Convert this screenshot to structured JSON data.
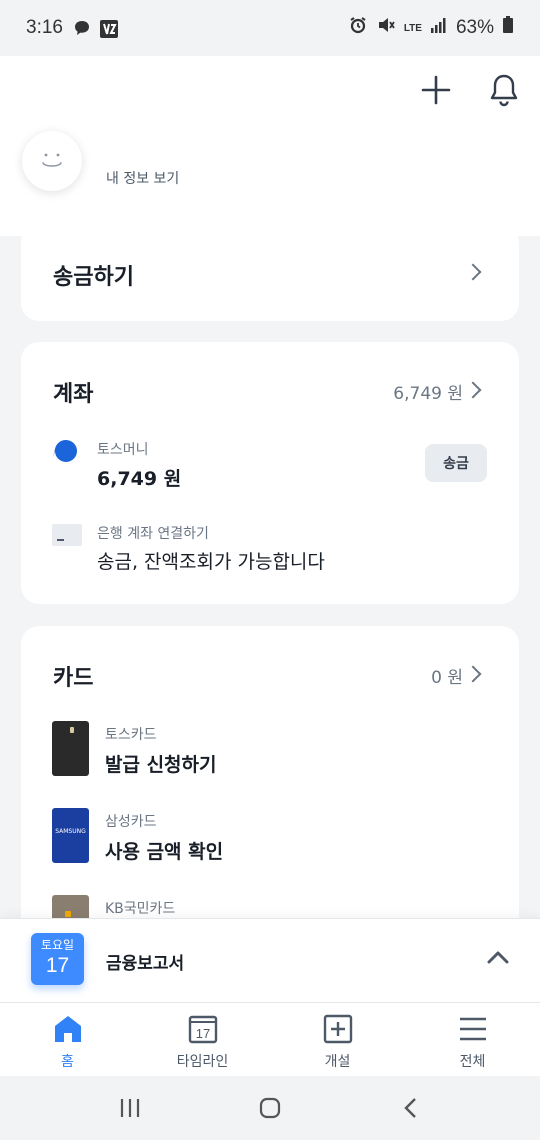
{
  "status_bar": {
    "time": "3:16",
    "network": "LTE",
    "battery": "63%"
  },
  "header": {
    "add_icon": "plus-icon",
    "notification_icon": "bell-icon",
    "profile_link": "내 정보 보기"
  },
  "transfer": {
    "title": "송금하기"
  },
  "accounts": {
    "title": "계좌",
    "total": "6,749 원",
    "items": [
      {
        "sub": "토스머니",
        "main": "6,749 원",
        "button": "송금",
        "icon_color": "#1b64da"
      },
      {
        "sub": "은행 계좌 연결하기",
        "main": "송금, 잔액조회가 가능합니다"
      }
    ]
  },
  "cards": {
    "title": "카드",
    "total": "0 원",
    "items": [
      {
        "sub": "토스카드",
        "main": "발급 신청하기",
        "color": "#2a2a2a"
      },
      {
        "sub": "삼성카드",
        "main": "사용 금액 확인",
        "color": "#1a3fa0",
        "logo_text": "SAMSUNG"
      },
      {
        "sub": "KB국민카드",
        "main": "",
        "color": "#8a7e70"
      }
    ]
  },
  "report": {
    "weekday": "토요일",
    "day": "17",
    "title": "금융보고서"
  },
  "tabs": [
    {
      "label": "홈",
      "icon": "home-icon",
      "active": true
    },
    {
      "label": "타임라인",
      "icon": "calendar-icon",
      "icon_text": "17",
      "active": false
    },
    {
      "label": "개설",
      "icon": "plus-square-icon",
      "active": false
    },
    {
      "label": "전체",
      "icon": "menu-icon",
      "active": false
    }
  ],
  "colors": {
    "accent": "#3182f6",
    "background": "#f2f4f6",
    "calendar_badge": "#3d8bff"
  }
}
